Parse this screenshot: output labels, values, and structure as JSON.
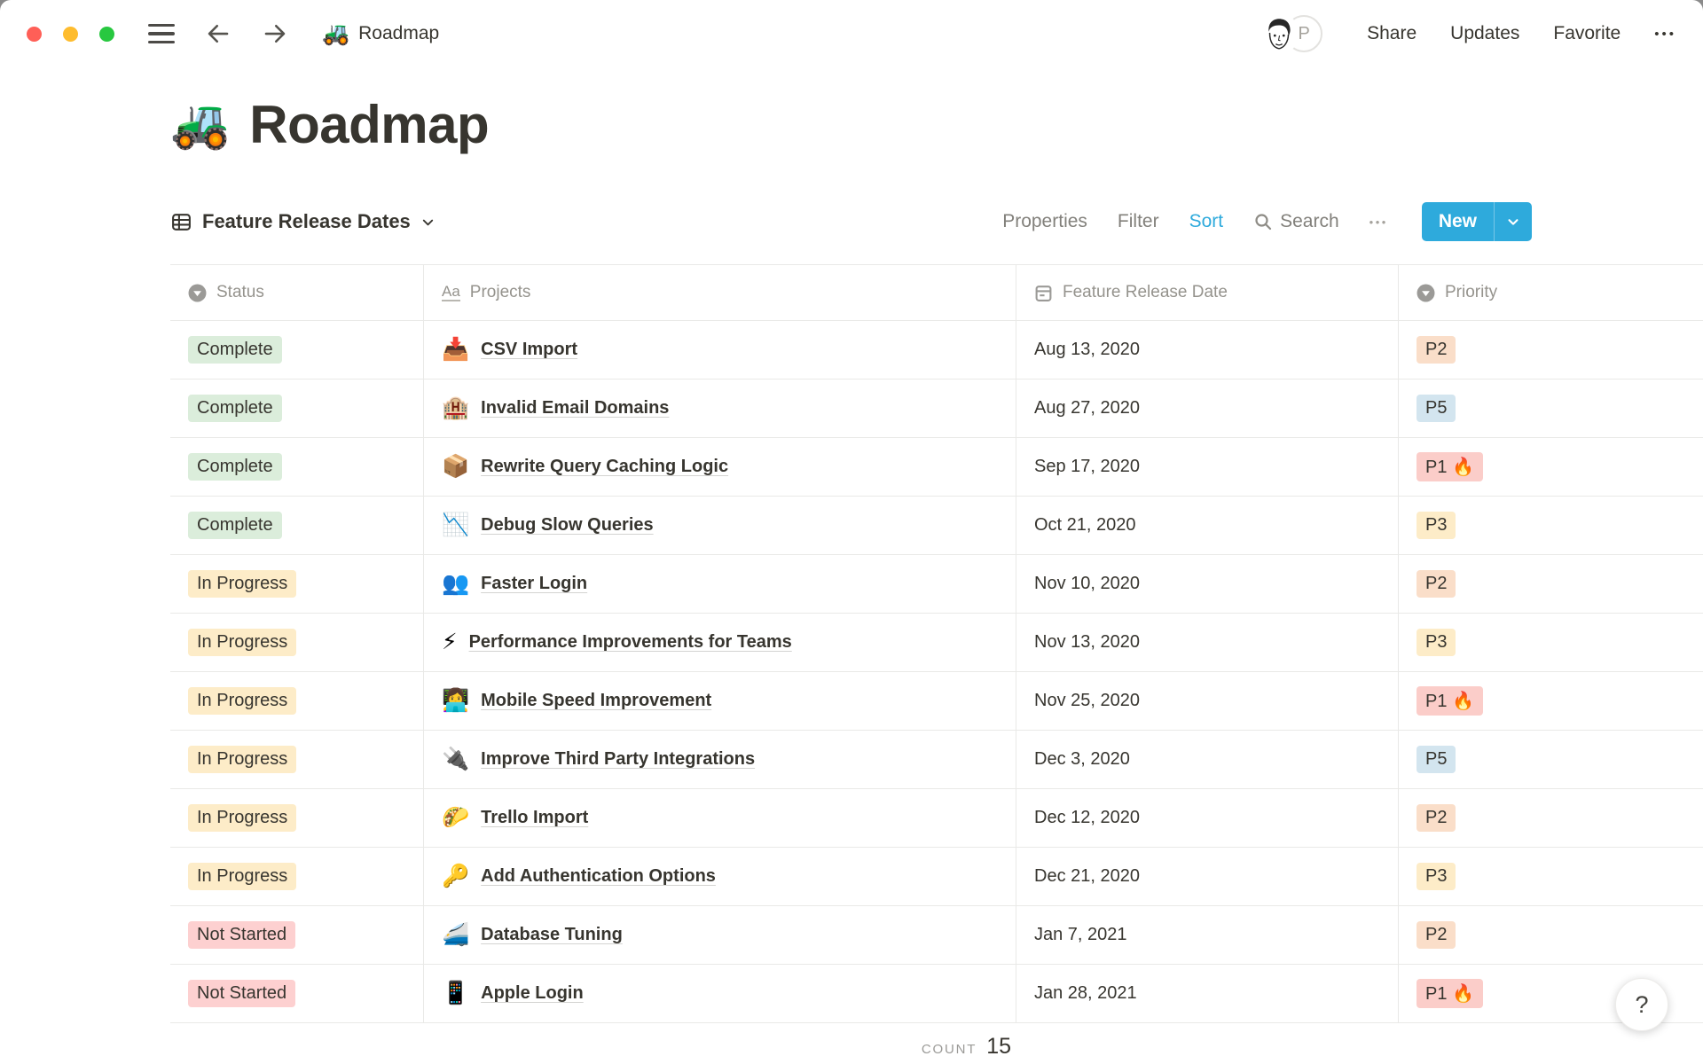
{
  "topbar": {
    "title_emoji": "🚜",
    "title": "Roadmap",
    "avatar_initial": "P",
    "share": "Share",
    "updates": "Updates",
    "favorite": "Favorite",
    "more": "•••"
  },
  "page": {
    "emoji": "🚜",
    "title": "Roadmap"
  },
  "toolbar": {
    "view_name": "Feature Release Dates",
    "properties": "Properties",
    "filter": "Filter",
    "sort": "Sort",
    "search": "Search",
    "more": "•••",
    "new_label": "New"
  },
  "table": {
    "columns": [
      {
        "label": "Status",
        "icon": "select-icon"
      },
      {
        "label": "Projects",
        "icon": "text-icon",
        "icon_text": "Aa"
      },
      {
        "label": "Feature Release Date",
        "icon": "calendar-icon"
      },
      {
        "label": "Priority",
        "icon": "select-icon"
      }
    ],
    "rows": [
      {
        "status": "Complete",
        "status_bg": "#DBEDDB",
        "emoji": "📥",
        "project": "CSV Import",
        "date": "Aug 13, 2020",
        "priority": "P2",
        "priority_bg": "#FADEC9"
      },
      {
        "status": "Complete",
        "status_bg": "#DBEDDB",
        "emoji": "🏨",
        "project": "Invalid Email Domains",
        "date": "Aug 27, 2020",
        "priority": "P5",
        "priority_bg": "#D3E5EF"
      },
      {
        "status": "Complete",
        "status_bg": "#DBEDDB",
        "emoji": "📦",
        "project": "Rewrite Query Caching Logic",
        "date": "Sep 17, 2020",
        "priority": "P1 🔥",
        "priority_bg": "#FBCDC9"
      },
      {
        "status": "Complete",
        "status_bg": "#DBEDDB",
        "emoji": "📉",
        "project": "Debug Slow Queries",
        "date": "Oct 21, 2020",
        "priority": "P3",
        "priority_bg": "#FDECC8"
      },
      {
        "status": "In Progress",
        "status_bg": "#FDECC8",
        "emoji": "👥",
        "project": "Faster Login",
        "date": "Nov 10, 2020",
        "priority": "P2",
        "priority_bg": "#FADEC9"
      },
      {
        "status": "In Progress",
        "status_bg": "#FDECC8",
        "emoji": "⚡",
        "project": "Performance Improvements for Teams",
        "date": "Nov 13, 2020",
        "priority": "P3",
        "priority_bg": "#FDECC8"
      },
      {
        "status": "In Progress",
        "status_bg": "#FDECC8",
        "emoji": "👩‍💻",
        "project": "Mobile Speed Improvement",
        "date": "Nov 25, 2020",
        "priority": "P1 🔥",
        "priority_bg": "#FBCDC9"
      },
      {
        "status": "In Progress",
        "status_bg": "#FDECC8",
        "emoji": "🔌",
        "project": "Improve Third Party Integrations",
        "date": "Dec 3, 2020",
        "priority": "P5",
        "priority_bg": "#D3E5EF"
      },
      {
        "status": "In Progress",
        "status_bg": "#FDECC8",
        "emoji": "🌮",
        "project": "Trello Import",
        "date": "Dec 12, 2020",
        "priority": "P2",
        "priority_bg": "#FADEC9"
      },
      {
        "status": "In Progress",
        "status_bg": "#FDECC8",
        "emoji": "🔑",
        "project": "Add Authentication Options",
        "date": "Dec 21, 2020",
        "priority": "P3",
        "priority_bg": "#FDECC8"
      },
      {
        "status": "Not Started",
        "status_bg": "#FDD0D0",
        "emoji": "🚄",
        "project": "Database Tuning",
        "date": "Jan 7, 2021",
        "priority": "P2",
        "priority_bg": "#FADEC9"
      },
      {
        "status": "Not Started",
        "status_bg": "#FDD0D0",
        "emoji": "📱",
        "project": "Apple Login",
        "date": "Jan 28, 2021",
        "priority": "P1 🔥",
        "priority_bg": "#FBCDC9"
      }
    ],
    "footer": {
      "count_label": "COUNT",
      "count_value": "15"
    }
  },
  "help_label": "?",
  "colors": {
    "accent_blue": "#2EAADC",
    "text_dark": "#37352F",
    "status_complete_bg": "#DBEDDB",
    "status_in_progress_bg": "#FDECC8",
    "status_not_started_bg": "#FDD0D0",
    "priority_p1_bg": "#FBCDC9",
    "priority_p2_bg": "#FADEC9",
    "priority_p3_bg": "#FDECC8",
    "priority_p5_bg": "#D3E5EF"
  }
}
